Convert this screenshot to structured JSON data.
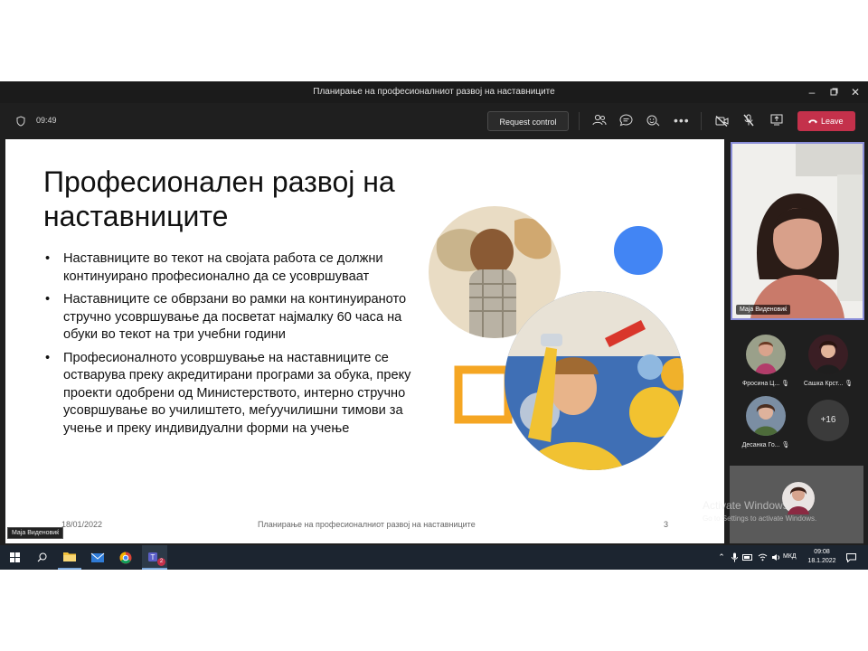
{
  "window": {
    "title": "Планирање на професионалниот развој на наставниците"
  },
  "toolbar": {
    "timer": "09:49",
    "request_control_label": "Request control",
    "leave_label": "Leave",
    "leave_color": "#c4314b"
  },
  "slide": {
    "title": "Професионален развој на наставниците",
    "bullets": [
      "Наставниците во текот на својата работа се должни континуирано професионално да се усовршуваат",
      "Наставниците се обврзани во рамки на континуираното стручно усовршување да посветат најмалку 60 часа на обуки во текот на три учебни години",
      "Професионалното усовршување на наставниците се остварува преку акредитирани програми за обука, преку проекти одобрени од Министерството, интерно стручно усовршување во училиштето, меѓуучилишни тимови за учење и преку индивидуални форми на учење"
    ],
    "footer_date": "18/01/2022",
    "footer_title": "Планирање на професионалниот развој на наставниците",
    "page_number": "3"
  },
  "speaker": {
    "name": "Маја Виденовиќ",
    "border_color": "#8a8ed8"
  },
  "participants": [
    {
      "name": "Фросина Ц..."
    },
    {
      "name": "Сашка Крст..."
    },
    {
      "name": "Десанка Го..."
    }
  ],
  "more_participants": "+16",
  "watermark": {
    "line1": "Activate Windows",
    "line2": "Go to Settings to activate Windows."
  },
  "presenter_label": "Маја Виденовиќ",
  "taskbar": {
    "language": "МКД",
    "time": "09:08",
    "date": "18.1.2022",
    "teams_badge": "2"
  }
}
